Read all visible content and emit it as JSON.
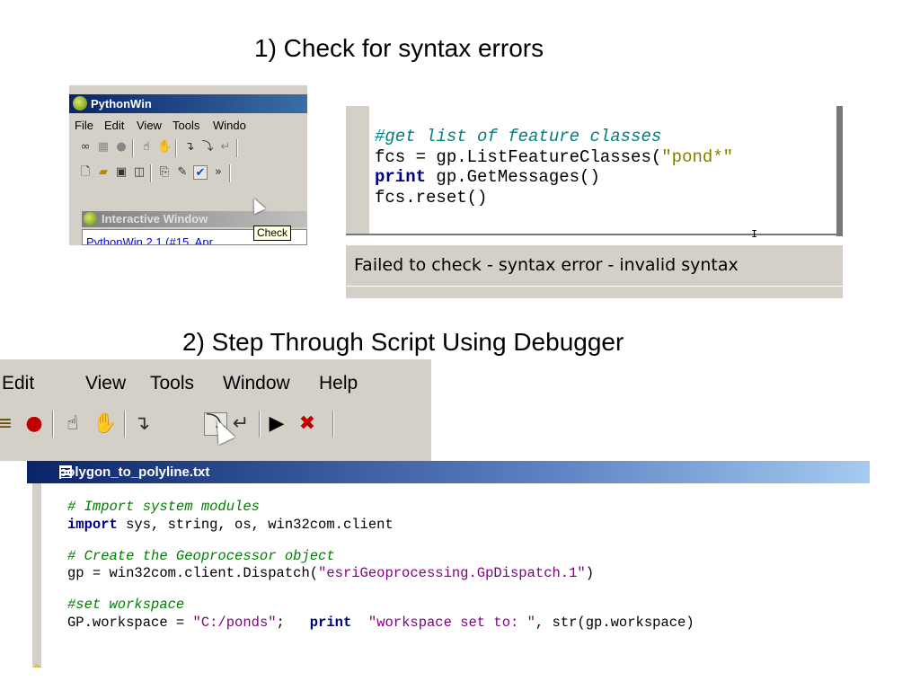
{
  "headings": {
    "step1": "1) Check for syntax errors",
    "step2": "2) Step Through Script Using Debugger"
  },
  "pythonwin": {
    "title": "PythonWin",
    "menu": [
      "File",
      "Edit",
      "View",
      "Tools",
      "Windo"
    ],
    "interactive_title": "Interactive Window",
    "interactive_text": "PythonWin 2.1 (#15, Apr",
    "tooltip": "Check"
  },
  "check_code": {
    "lines": [
      [
        {
          "t": "#get list of feature classes",
          "c": "cm"
        }
      ],
      [
        {
          "t": "fcs = gp.ListFeatureClasses(",
          "c": ""
        },
        {
          "t": "\"pond*\"",
          "c": "str"
        }
      ],
      [
        {
          "t": "print",
          "c": "kw"
        },
        {
          "t": " gp.GetMessages()",
          "c": ""
        }
      ],
      [
        {
          "t": "fcs.reset()",
          "c": ""
        }
      ]
    ],
    "status": "Failed to check - syntax error - invalid syntax"
  },
  "debugger": {
    "menu": [
      "Edit",
      "View",
      "Tools",
      "Window",
      "Help"
    ]
  },
  "editor": {
    "title": "polygon_to_polyline.txt",
    "lines": [
      [
        {
          "t": "# Import system modules",
          "c": "cm2"
        }
      ],
      [
        {
          "t": "import",
          "c": "kw"
        },
        {
          "t": " sys, string, os, win32com.client",
          "c": ""
        }
      ],
      [
        {
          "t": "",
          "c": ""
        }
      ],
      [
        {
          "t": "# Create the Geoprocessor object",
          "c": "cm2"
        }
      ],
      [
        {
          "t": "gp = win32com.client.Dispatch(",
          "c": ""
        },
        {
          "t": "\"esriGeoprocessing.GpDispatch.1\"",
          "c": "str2"
        },
        {
          "t": ")",
          "c": ""
        }
      ],
      [
        {
          "t": "",
          "c": ""
        }
      ],
      [
        {
          "t": "#set workspace",
          "c": "cm2"
        }
      ],
      [
        {
          "t": "GP.workspace = ",
          "c": ""
        },
        {
          "t": "\"C:/ponds\"",
          "c": "str2"
        },
        {
          "t": ";   ",
          "c": ""
        },
        {
          "t": "print",
          "c": "kw"
        },
        {
          "t": "  ",
          "c": ""
        },
        {
          "t": "\"workspace set to: \"",
          "c": "str2"
        },
        {
          "t": ", str(gp.workspace)",
          "c": ""
        }
      ]
    ]
  },
  "icons": {
    "toolbar1_row1": [
      "glasses-icon",
      "grid-icon",
      "breakpoint-icon",
      "hand-icon",
      "stop-hand-icon",
      "step-in-icon",
      "step-over-icon",
      "step-out-icon"
    ],
    "toolbar1_row2": [
      "new-file-icon",
      "open-folder-icon",
      "save-icon",
      "save-all-icon",
      "copy-icon",
      "run-icon",
      "check-icon",
      "more-icon"
    ],
    "toolbar3": [
      "watch-icon",
      "breakpoint-icon",
      "hand-icon",
      "stop-hand-icon",
      "step-icon",
      "step-over-icon",
      "step-out-icon",
      "go-icon",
      "close-debugger-icon"
    ]
  }
}
